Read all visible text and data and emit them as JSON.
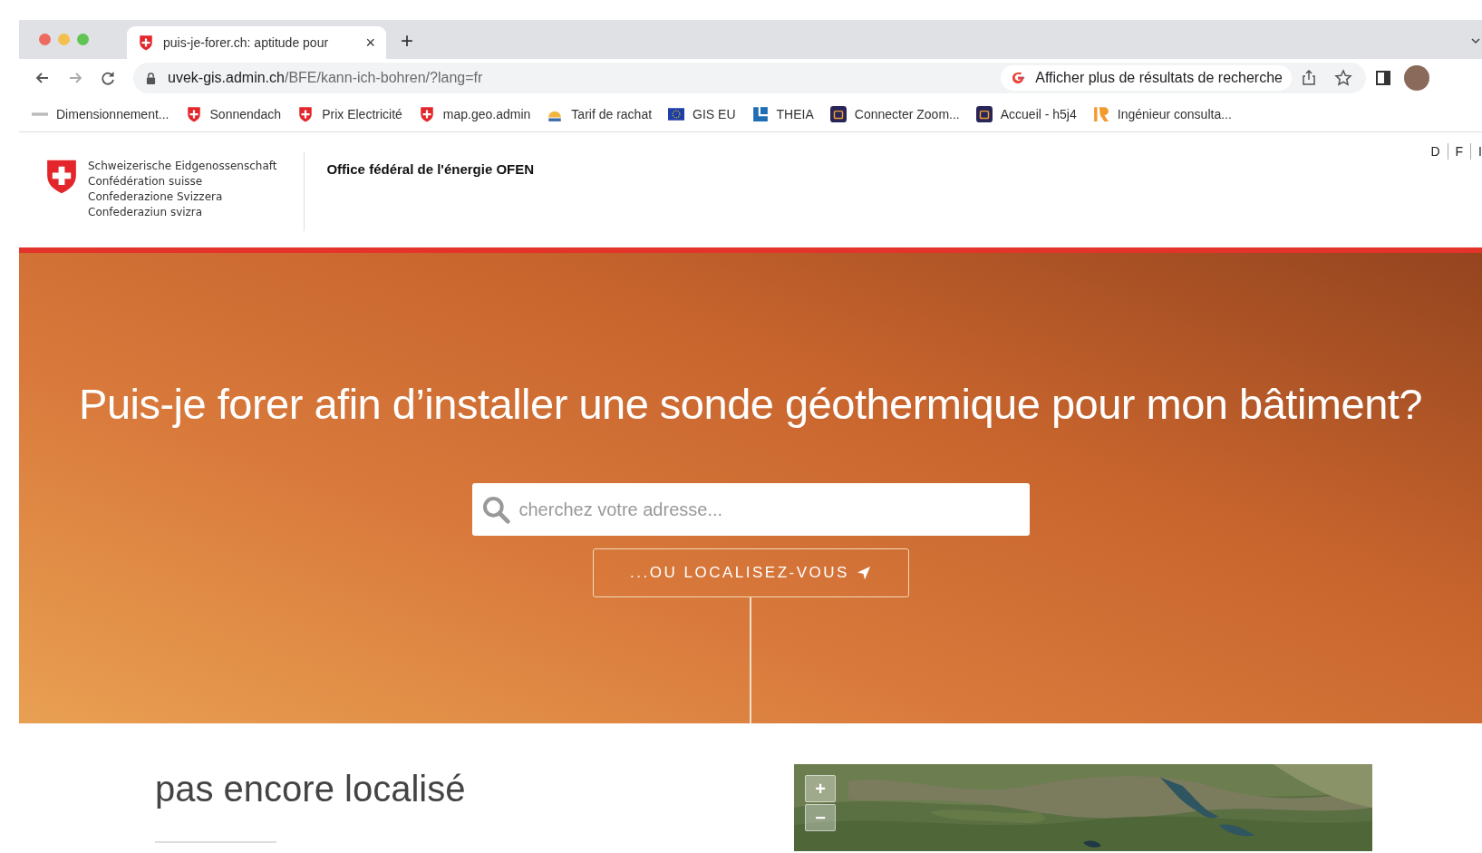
{
  "browser": {
    "tab": {
      "title": "puis-je-forer.ch: aptitude pour",
      "close": "×"
    },
    "new_tab": "+",
    "address": {
      "host": "uvek-gis.admin.ch",
      "path": "/BFE/kann-ich-bohren/?lang=fr"
    },
    "search_chip": "Afficher plus de résultats de recherche",
    "bookmarks": [
      {
        "kind": "grey",
        "label": "Dimensionnement..."
      },
      {
        "kind": "swiss",
        "label": "Sonnendach"
      },
      {
        "kind": "swiss",
        "label": "Prix Electricité"
      },
      {
        "kind": "swiss",
        "label": "map.geo.admin"
      },
      {
        "kind": "sun",
        "label": "Tarif de rachat"
      },
      {
        "kind": "eu",
        "label": "GIS EU"
      },
      {
        "kind": "theia",
        "label": "THEIA"
      },
      {
        "kind": "zoom",
        "label": "Connecter Zoom..."
      },
      {
        "kind": "zoom",
        "label": "Accueil - h5j4"
      },
      {
        "kind": "r",
        "label": "Ingénieur consulta..."
      }
    ]
  },
  "header": {
    "federation": [
      "Schweizerische Eidgenossenschaft",
      "Confédération suisse",
      "Confederazione Svizzera",
      "Confederaziun svizra"
    ],
    "office": "Office fédéral de l'énergie OFEN",
    "languages": [
      "D",
      "F",
      "I"
    ]
  },
  "hero": {
    "title": "Puis-je forer afin d’installer une sonde géothermique pour mon bâtiment?",
    "search": {
      "placeholder": "cherchez votre adresse..."
    },
    "locate_button": "...OU LOCALISEZ-VOUS"
  },
  "result": {
    "title": "pas encore localisé"
  },
  "map": {
    "zoom_in": "+",
    "zoom_out": "−"
  }
}
